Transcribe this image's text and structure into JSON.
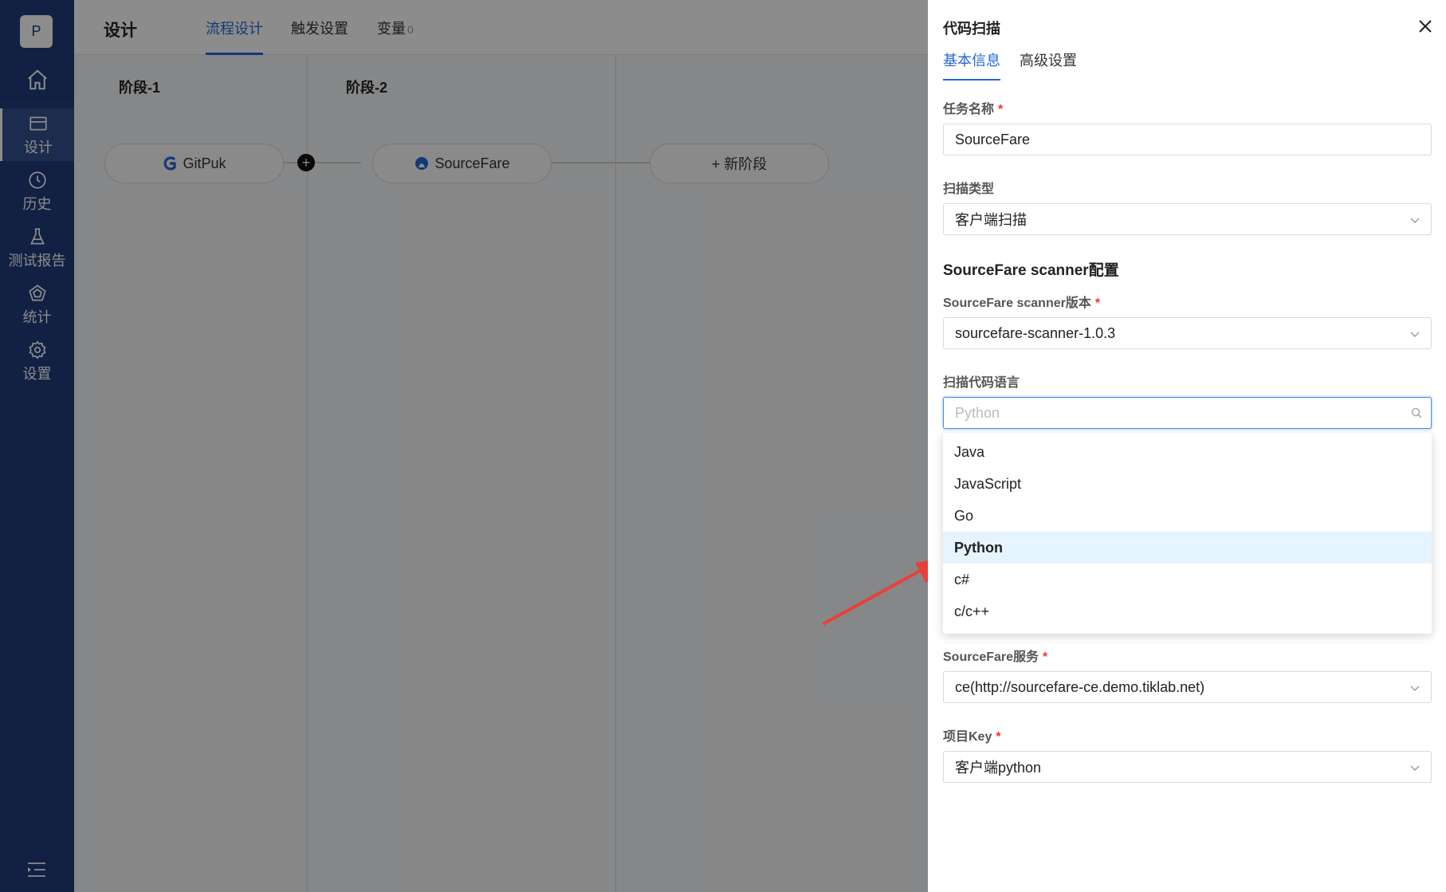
{
  "sidebar": {
    "avatar_letter": "P",
    "items": [
      {
        "label": "设计",
        "icon": "design-icon",
        "active": true
      },
      {
        "label": "历史",
        "icon": "clock-icon"
      },
      {
        "label": "测试报告",
        "icon": "flask-icon"
      },
      {
        "label": "统计",
        "icon": "chart-icon"
      },
      {
        "label": "设置",
        "icon": "gear-icon"
      }
    ]
  },
  "header": {
    "title": "设计",
    "tabs": [
      {
        "label": "流程设计",
        "active": true
      },
      {
        "label": "触发设置"
      },
      {
        "label": "变量",
        "count": "0"
      }
    ]
  },
  "pipeline": {
    "stages": [
      {
        "title": "阶段-1",
        "task": "GitPuk",
        "icon": "gitpuk-icon"
      },
      {
        "title": "阶段-2",
        "task": "SourceFare",
        "icon": "sourcefare-icon"
      }
    ],
    "new_stage_label": "+ 新阶段"
  },
  "drawer": {
    "title": "代码扫描",
    "tabs": [
      {
        "label": "基本信息",
        "active": true
      },
      {
        "label": "高级设置"
      }
    ],
    "fields": {
      "task_name": {
        "label": "任务名称",
        "required": true,
        "value": "SourceFare"
      },
      "scan_type": {
        "label": "扫描类型",
        "value": "客户端扫描"
      },
      "section_title": "SourceFare scanner配置",
      "scanner_version": {
        "label": "SourceFare scanner版本",
        "required": true,
        "value": "sourcefare-scanner-1.0.3"
      },
      "scan_language": {
        "label": "扫描代码语言",
        "placeholder": "Python"
      },
      "service": {
        "label": "SourceFare服务",
        "required": true,
        "value": "ce(http://sourcefare-ce.demo.tiklab.net)"
      },
      "project_key": {
        "label": "项目Key",
        "required": true,
        "value": "客户端python"
      }
    },
    "language_options": [
      "Java",
      "JavaScript",
      "Go",
      "Python",
      "c#",
      "c/c++"
    ],
    "selected_language": "Python",
    "required_mark": "*"
  },
  "colors": {
    "sidebar": "#1f3b7a",
    "accent": "#2467d8",
    "annotation_arrow": "#e8403a",
    "selected_option_bg": "#e6f4ff"
  }
}
